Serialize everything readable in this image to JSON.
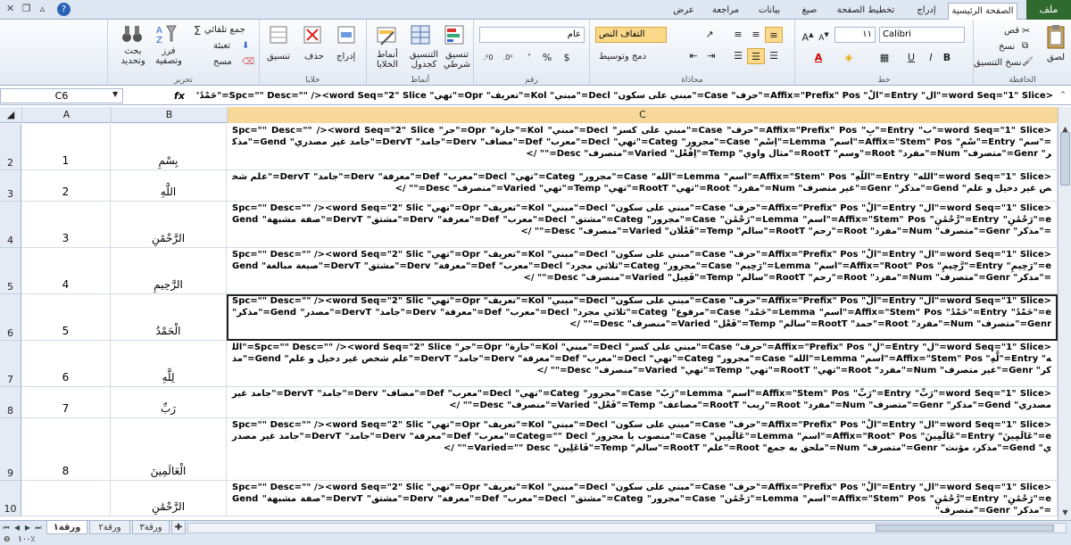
{
  "window": {
    "file_tab": "ملف",
    "tabs": [
      "الصفحة الرئيسية",
      "إدراج",
      "تخطيط الصفحة",
      "صيغ",
      "بيانات",
      "مراجعة",
      "عرض"
    ],
    "help": "?"
  },
  "ribbon": {
    "clipboard": {
      "label": "الحافظة",
      "paste": "لصق",
      "cut": "قص",
      "copy": "نسخ",
      "format_painter": "نسخ التنسيق"
    },
    "font": {
      "label": "خط",
      "name": "Calibri",
      "size": "١١",
      "bold": "B",
      "italic": "I",
      "underline": "U"
    },
    "alignment": {
      "label": "محاذاة",
      "wrap": "التفاف النص",
      "merge": "دمج وتوسيط"
    },
    "number": {
      "label": "رقم",
      "format": "عام",
      "percent": "%",
      "comma": "٬"
    },
    "styles": {
      "label": "أنماط",
      "conditional": "تنسيق شرطي",
      "as_table": "التنسيق كجدول",
      "cell_styles": "أنماط الخلايا"
    },
    "cells": {
      "label": "خلايا",
      "insert": "إدراج",
      "delete": "حذف",
      "format": "تنسيق"
    },
    "editing": {
      "label": "تحرير",
      "autosum": "جمع تلقائي",
      "fill": "تعبئة",
      "clear": "مسح",
      "sort": "فرز وتصفية",
      "find": "بحث وتحديد"
    }
  },
  "formula_bar": {
    "name_box": "C6",
    "fx": "fx",
    "formula": "<word Seq=\"1\" Slice=\"ال\" Entry=\"الْ\" Affix=\"Prefix\" Pos=\"حرف\" Case=\"مبني على سكون\" Decl=\"مبني\" Kol=\"تعريف\" Opr=\"تهي\" Spc=\"\" Desc=\"\" /><word Seq=\"2\" Slice=\"حَمْدُ\" Entry=\"حَمْدُ\""
  },
  "grid": {
    "columns": [
      "A",
      "B",
      "C"
    ],
    "rows": [
      {
        "num": "2",
        "a": "1",
        "b": "بِسْمِ",
        "c": "<word Seq=\"1\" Slice=\"ب\" Entry=\"بِ\" Affix=\"Prefix\" Pos=\"حرف\" Case=\"مبني على كسر\" Decl=\"مبني\" Kol=\"جارة\" Opr=\"جر\" Spc=\"\" Desc=\"\" /><word Seq=\"2\" Slice=\"سم\" Entry=\"سْمِ\" Affix=\"Stem\" Pos=\"اسم\" Lemma=\"اِسْم\" Case=\"مجرور\" Categ=\"تهي\" Decl=\"معرب\" Def=\"مضاف\" Derv=\"جامد\" DervT=\"جامد غير مصدري\" Gend=\"مذكر\" Genr=\"متصرف\" Num=\"مفرد\" Root=\"وسم\" RootT=\"مثال واوي\" Temp=\"اِفْعْل\" Varied=\"متصرف\" Desc=\"\" />"
      },
      {
        "num": "3",
        "a": "2",
        "b": "اللَّهِ",
        "c": "<word Seq=\"1\" Slice=\"الله\" Entry=\"اللَّهِ\" Affix=\"Stem\" Pos=\"اسم\" Lemma=\"الله\" Case=\"مجرور\" Categ=\"تهي\" Decl=\"معرب\" Def=\"معرفة\" Derv=\"جامد\" DervT=\"علم شخص غير دخيل و علم\" Gend=\"مذكر\" Genr=\"غير متصرف\" Num=\"مفرد\" Root=\"تهي\" RootT=\"تهي\" Temp=\"تهي\" Varied=\"منصرف\" Desc=\"\" />"
      },
      {
        "num": "4",
        "a": "3",
        "b": "الرَّحْمَٰنِ",
        "c": "<word Seq=\"1\" Slice=\"ال\" Entry=\"الْ\" Affix=\"Prefix\" Pos=\"حرف\" Case=\"مبني على سكون\" Decl=\"مبني\" Kol=\"تعريف\" Opr=\"تهي\" Spc=\"\" Desc=\"\" /><word Seq=\"2\" Slice=\"رَحْمَٰنِ\" Entry=\"رَّحْمَٰنِ\" Affix=\"Stem\" Pos=\"اسم\" Lemma=\"رَحْمَٰن\" Case=\"مجرور\" Categ=\"مشتق\" Decl=\"معرب\" Def=\"معرفة\" Derv=\"مشتق\" DervT=\"صفة مشبهة\" Gend=\"مذكر\" Genr=\"متصرف\" Num=\"مفرد\" Root=\"رحم\" RootT=\"سالم\" Temp=\"فَعْلَان\" Varied=\"منصرف\" Desc=\"\" />"
      },
      {
        "num": "5",
        "a": "4",
        "b": "الرَّحِيمِ",
        "c": "<word Seq=\"1\" Slice=\"ال\" Entry=\"الْ\" Affix=\"Prefix\" Pos=\"حرف\" Case=\"مبني على سكون\" Decl=\"مبني\" Kol=\"تعريف\" Opr=\"تهي\" Spc=\"\" Desc=\"\" /><word Seq=\"2\" Slice=\"رَحِيمِ\" Entry=\"رَّحِيمِ\" Affix=\"Root\" Pos=\"اسم\" Lemma=\"رَحِيم\" Case=\"مجرور\" Categ=\"ثلاثي مجرد\" Decl=\"معرب\" Def=\"معرفة\" Derv=\"مشتق\" DervT=\"صيغة مبالغة\" Gend=\"مذكر\" Genr=\"متصرف\" Num=\"مفرد\" Root=\"رحم\" RootT=\"سالم\" Temp=\"فَعِيل\" Varied=\"منصرف\" Desc=\"\" />"
      },
      {
        "num": "6",
        "a": "5",
        "b": "الْحَمْدُ",
        "c": "<word Seq=\"1\" Slice=\"ال\" Entry=\"الْ\" Affix=\"Prefix\" Pos=\"حرف\" Case=\"مبني على سكون\" Decl=\"مبني\" Kol=\"تعريف\" Opr=\"تهي\" Spc=\"\" Desc=\"\" /><word Seq=\"2\" Slice=\"حَمْدُ\" Entry=\"حَمْدُ\" Affix=\"Stem\" Pos=\"اسم\" Lemma=\"حَمْد\" Case=\"مرفوع\" Categ=\"ثلاثي مجرد\" Decl=\"معرب\" Def=\"معرفة\" Derv=\"جامد\" DervT=\"مصدر\" Gend=\"مذكر\" Genr=\"متصرف\" Num=\"مفرد\" Root=\"حمد\" RootT=\"سالم\" Temp=\"فَعْل\" Varied=\"منصرف\" Desc=\"\" />"
      },
      {
        "num": "7",
        "a": "6",
        "b": "لِلَّهِ",
        "c": "<word Seq=\"1\" Slice=\"ل\" Entry=\"لِ\" Affix=\"Prefix\" Pos=\"حرف\" Case=\"مبني على كسر\" Decl=\"مبني\" Kol=\"جارة\" Opr=\"جر\" Spc=\"\" Desc=\"\" /><word Seq=\"2\" Slice=\"الله\" Entry=\"لَّهِ\" Affix=\"Stem\" Pos=\"اسم\" Lemma=\"الله\" Case=\"مجرور\" Categ=\"تهي\" Decl=\"معرب\" Def=\"معرفة\" Derv=\"جامد\" DervT=\"علم شخص غير دخيل و علم\" Gend=\"مذكر\" Genr=\"غير متصرف\" Num=\"مفرد\" Root=\"تهي\" RootT=\"تهي\" Temp=\"تهي\" Varied=\"منصرف\" Desc=\"\" />"
      },
      {
        "num": "8",
        "a": "7",
        "b": "رَبِّ",
        "c": "<word Seq=\"1\" Slice=\"رَبِّ\" Entry=\"رَبِّ\" Affix=\"Stem\" Pos=\"اسم\" Lemma=\"رَبّ\" Case=\"مجرور\" Categ=\"تهي\" Decl=\"معرب\" Def=\"مضاف\" Derv=\"جامد\" DervT=\"جامد غير مصدري\" Gend=\"مذكر\" Genr=\"متصرف\" Num=\"مفرد\" Root=\"ربب\" RootT=\"مضاعف\" Temp=\"فَعْل\" Varied=\"منصرف\" Desc=\"\" />"
      },
      {
        "num": "9",
        "a": "8",
        "b": "الْعَالَمِينَ",
        "c": "<word Seq=\"1\" Slice=\"ال\" Entry=\"الْ\" Affix=\"Prefix\" Pos=\"حرف\" Case=\"مبني على سكون\" Decl=\"مبني\" Kol=\"تعريف\" Opr=\"تهي\" Spc=\"\" Desc=\"\" /><word Seq=\"2\" Slice=\"عَالَمِينَ\" Entry=\"عَالَمِينَ\" Affix=\"Root\" Pos=\"اسم\" Lemma=\"عَالَمِين\" Case=\"منصوب يا مجرور\" Categ=\"\" Decl=\"معرب\" Def=\"معرفة\" Derv=\"جامد\" DervT=\"جامد غير مصدري\" Gend=\"مذكر، مؤنث\" Genr=\"متصرف\" Num=\"ملحق به جمع\" Root=\"علم\" RootT=\"سالم\" Temp=\"فَاعَلِين\" Varied=\"\" Desc=\"\" />"
      },
      {
        "num": "10",
        "a": "",
        "b": "الرَّحْمَٰنِ",
        "c": "<word Seq=\"1\" Slice=\"ال\" Entry=\"الْ\" Affix=\"Prefix\" Pos=\"حرف\" Case=\"مبني على سكون\" Decl=\"مبني\" Kol=\"تعريف\" Opr=\"تهي\" Spc=\"\" Desc=\"\" /><word Seq=\"2\" Slice=\"رَحْمَٰنِ\" Entry=\"رَّحْمَٰنِ\" Affix=\"Stem\" Pos=\"اسم\" Lemma=\"رَحْمَٰن\" Case=\"مجرور\" Categ=\"مشتق\" Decl=\"معرب\" Def=\"معرفة\" Derv=\"مشتق\" DervT=\"صفة مشبهة\" Gend=\"مذكر\" Genr=\"متصرف\""
      }
    ]
  },
  "sheets": {
    "tabs": [
      "ورقة١",
      "ورقة٢",
      "ورقة٣"
    ]
  },
  "status": {
    "zoom": "١٠٠٪"
  },
  "colors": {
    "file_tab": "#2f6a2e",
    "highlight": "#fbd98a",
    "header_bg": "#e4ebf5"
  }
}
